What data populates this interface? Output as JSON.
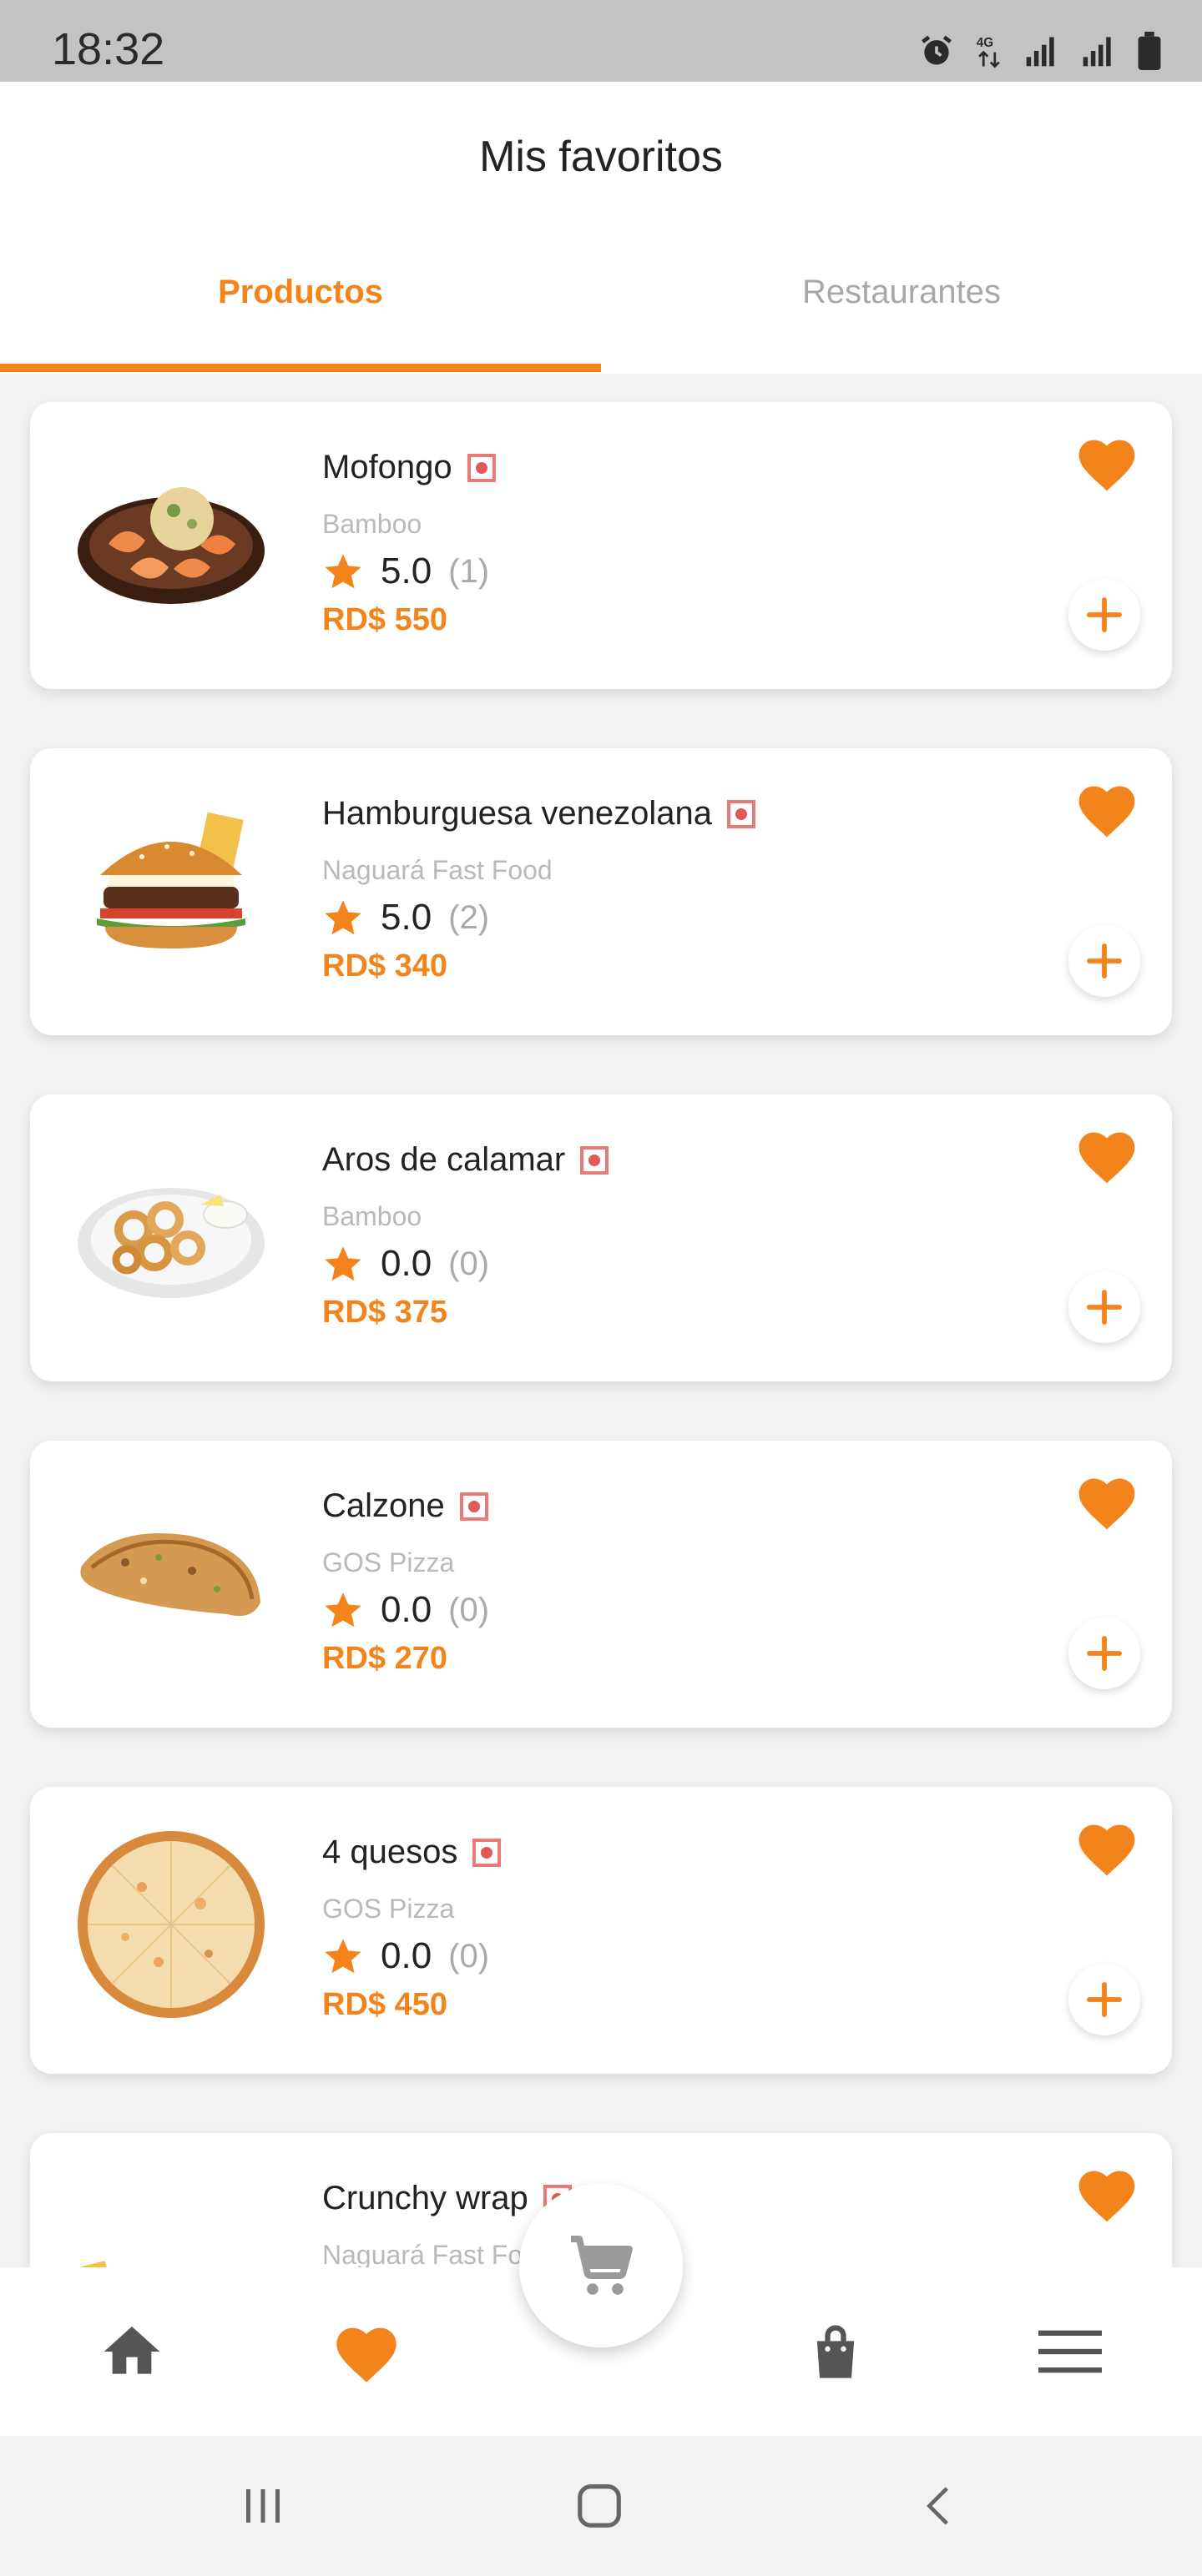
{
  "status_bar": {
    "time": "18:32",
    "icons": [
      "alarm-icon",
      "data-4g-icon",
      "signal-icon",
      "signal-icon",
      "battery-icon"
    ]
  },
  "header": {
    "title": "Mis favoritos"
  },
  "tabs": [
    {
      "label": "Productos",
      "active": true
    },
    {
      "label": "Restaurantes",
      "active": false
    }
  ],
  "colors": {
    "accent": "#f3841b",
    "veg_badge": "#e05a5a",
    "muted": "#b9b9b9"
  },
  "favorites": [
    {
      "name": "Mofongo",
      "restaurant": "Bamboo",
      "rating": "5.0",
      "rating_count": "(1)",
      "price": "RD$ 550",
      "favorited": true
    },
    {
      "name": "Hamburguesa venezolana",
      "restaurant": "Naguará Fast Food",
      "rating": "5.0",
      "rating_count": "(2)",
      "price": "RD$ 340",
      "favorited": true
    },
    {
      "name": "Aros de calamar",
      "restaurant": "Bamboo",
      "rating": "0.0",
      "rating_count": "(0)",
      "price": "RD$ 375",
      "favorited": true
    },
    {
      "name": "Calzone",
      "restaurant": "GOS Pizza",
      "rating": "0.0",
      "rating_count": "(0)",
      "price": "RD$ 270",
      "favorited": true
    },
    {
      "name": "4 quesos",
      "restaurant": "GOS Pizza",
      "rating": "0.0",
      "rating_count": "(0)",
      "price": "RD$ 450",
      "favorited": true
    },
    {
      "name": "Crunchy wrap",
      "restaurant": "Naguará Fast Food",
      "rating": "",
      "rating_count": "",
      "price": "",
      "favorited": true
    }
  ],
  "bottom_nav": {
    "items": [
      "home-icon",
      "heart-icon",
      "cart-icon",
      "bag-icon",
      "menu-icon"
    ],
    "active": "heart-icon"
  }
}
